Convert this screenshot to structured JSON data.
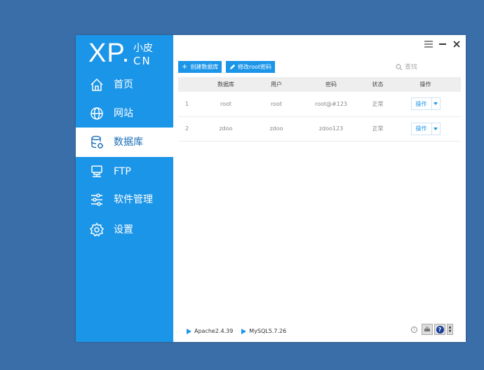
{
  "brand": {
    "logo_main": "XP",
    "logo_dot": ".",
    "logo_sub_top": "小皮",
    "logo_sub_bottom": "CN"
  },
  "nav": {
    "items": [
      {
        "label": "首页",
        "icon": "home-icon"
      },
      {
        "label": "网站",
        "icon": "globe-icon"
      },
      {
        "label": "数据库",
        "icon": "database-icon",
        "active": true
      },
      {
        "label": "FTP",
        "icon": "ftp-server-icon"
      },
      {
        "label": "软件管理",
        "icon": "sliders-icon"
      },
      {
        "label": "设置",
        "icon": "gear-icon"
      }
    ]
  },
  "toolbar": {
    "create_db_label": "创建数据库",
    "change_root_pw_label": "修改root密码",
    "search_placeholder": "查找"
  },
  "table": {
    "columns": [
      "",
      "数据库",
      "用户",
      "密码",
      "状态",
      "操作"
    ],
    "rows": [
      {
        "index": "1",
        "database": "root",
        "user": "root",
        "password": "root@#123",
        "status": "正常",
        "action": "操作"
      },
      {
        "index": "2",
        "database": "zdoo",
        "user": "zdoo",
        "password": "zdoo123",
        "status": "正常",
        "action": "操作"
      }
    ]
  },
  "status_bar": {
    "services": [
      {
        "name": "Apache2.4.39"
      },
      {
        "name": "MySQL5.7.26"
      }
    ]
  },
  "colors": {
    "accent": "#1b95e8",
    "desktop": "#3a6ea8"
  }
}
